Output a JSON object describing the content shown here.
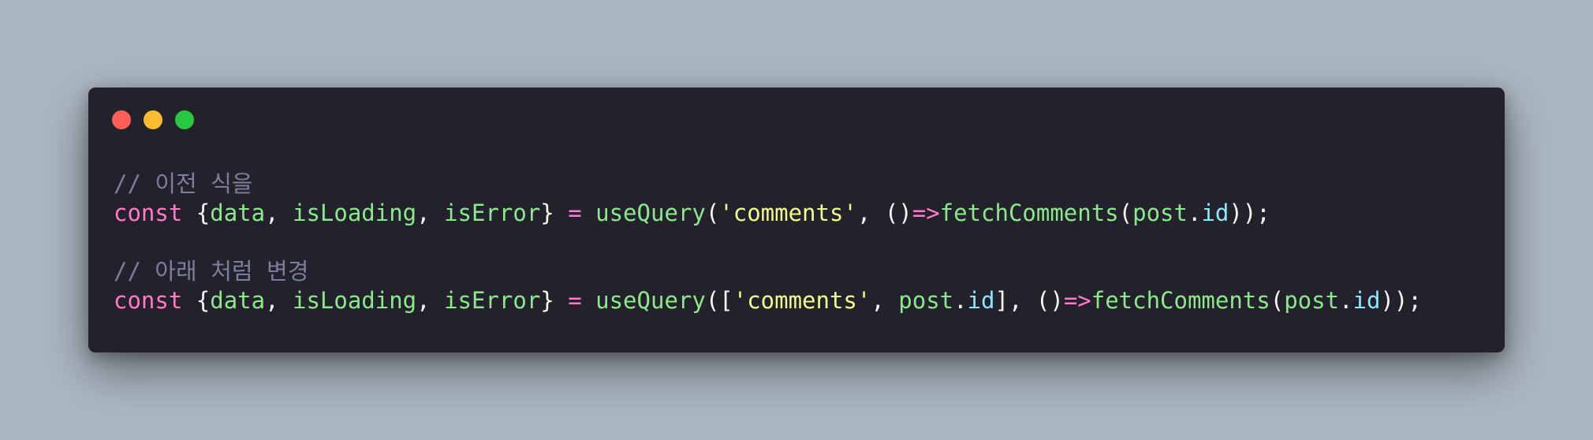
{
  "window": {
    "controls": {
      "close_color": "#ff5f57",
      "minimize_color": "#febc2e",
      "maximize_color": "#28c840"
    }
  },
  "code": {
    "lines": [
      {
        "tokens": [
          {
            "type": "comment",
            "text": "// 이전 식을"
          }
        ]
      },
      {
        "tokens": [
          {
            "type": "keyword",
            "text": "const"
          },
          {
            "type": "punct",
            "text": " {"
          },
          {
            "type": "ident",
            "text": "data"
          },
          {
            "type": "punct",
            "text": ", "
          },
          {
            "type": "ident",
            "text": "isLoading"
          },
          {
            "type": "punct",
            "text": ", "
          },
          {
            "type": "ident",
            "text": "isError"
          },
          {
            "type": "punct",
            "text": "} "
          },
          {
            "type": "op",
            "text": "="
          },
          {
            "type": "punct",
            "text": " "
          },
          {
            "type": "ident",
            "text": "useQuery"
          },
          {
            "type": "punct",
            "text": "("
          },
          {
            "type": "string",
            "text": "'comments'"
          },
          {
            "type": "punct",
            "text": ", ()"
          },
          {
            "type": "op",
            "text": "=>"
          },
          {
            "type": "ident",
            "text": "fetchComments"
          },
          {
            "type": "punct",
            "text": "("
          },
          {
            "type": "ident",
            "text": "post"
          },
          {
            "type": "punct",
            "text": "."
          },
          {
            "type": "prop",
            "text": "id"
          },
          {
            "type": "punct",
            "text": "));"
          }
        ]
      },
      {
        "tokens": []
      },
      {
        "tokens": [
          {
            "type": "comment",
            "text": "// 아래 처럼 변경"
          }
        ]
      },
      {
        "tokens": [
          {
            "type": "keyword",
            "text": "const"
          },
          {
            "type": "punct",
            "text": " {"
          },
          {
            "type": "ident",
            "text": "data"
          },
          {
            "type": "punct",
            "text": ", "
          },
          {
            "type": "ident",
            "text": "isLoading"
          },
          {
            "type": "punct",
            "text": ", "
          },
          {
            "type": "ident",
            "text": "isError"
          },
          {
            "type": "punct",
            "text": "} "
          },
          {
            "type": "op",
            "text": "="
          },
          {
            "type": "punct",
            "text": " "
          },
          {
            "type": "ident",
            "text": "useQuery"
          },
          {
            "type": "punct",
            "text": "(["
          },
          {
            "type": "string",
            "text": "'comments'"
          },
          {
            "type": "punct",
            "text": ", "
          },
          {
            "type": "ident",
            "text": "post"
          },
          {
            "type": "punct",
            "text": "."
          },
          {
            "type": "prop",
            "text": "id"
          },
          {
            "type": "punct",
            "text": "], ()"
          },
          {
            "type": "op",
            "text": "=>"
          },
          {
            "type": "ident",
            "text": "fetchComments"
          },
          {
            "type": "punct",
            "text": "("
          },
          {
            "type": "ident",
            "text": "post"
          },
          {
            "type": "punct",
            "text": "."
          },
          {
            "type": "prop",
            "text": "id"
          },
          {
            "type": "punct",
            "text": "));"
          }
        ]
      }
    ]
  }
}
